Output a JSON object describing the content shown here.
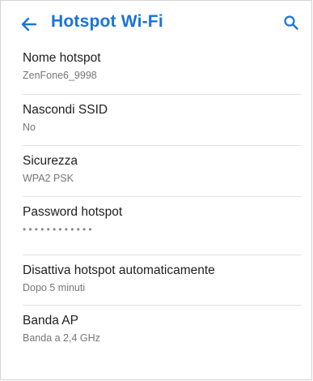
{
  "header": {
    "title": "Hotspot Wi-Fi",
    "back_icon": "arrow-left-icon",
    "search_icon": "search-icon",
    "accent_color": "#1a73d9"
  },
  "settings": [
    {
      "title": "Nome hotspot",
      "value": "ZenFone6_9998"
    },
    {
      "title": "Nascondi SSID",
      "value": "No"
    },
    {
      "title": "Sicurezza",
      "value": "WPA2 PSK"
    },
    {
      "title": "Password hotspot",
      "value": "••••••••••••"
    },
    {
      "title": "Disattiva hotspot automaticamente",
      "value": "Dopo 5 minuti"
    },
    {
      "title": "Banda AP",
      "value": "Banda a 2,4 GHz"
    }
  ]
}
